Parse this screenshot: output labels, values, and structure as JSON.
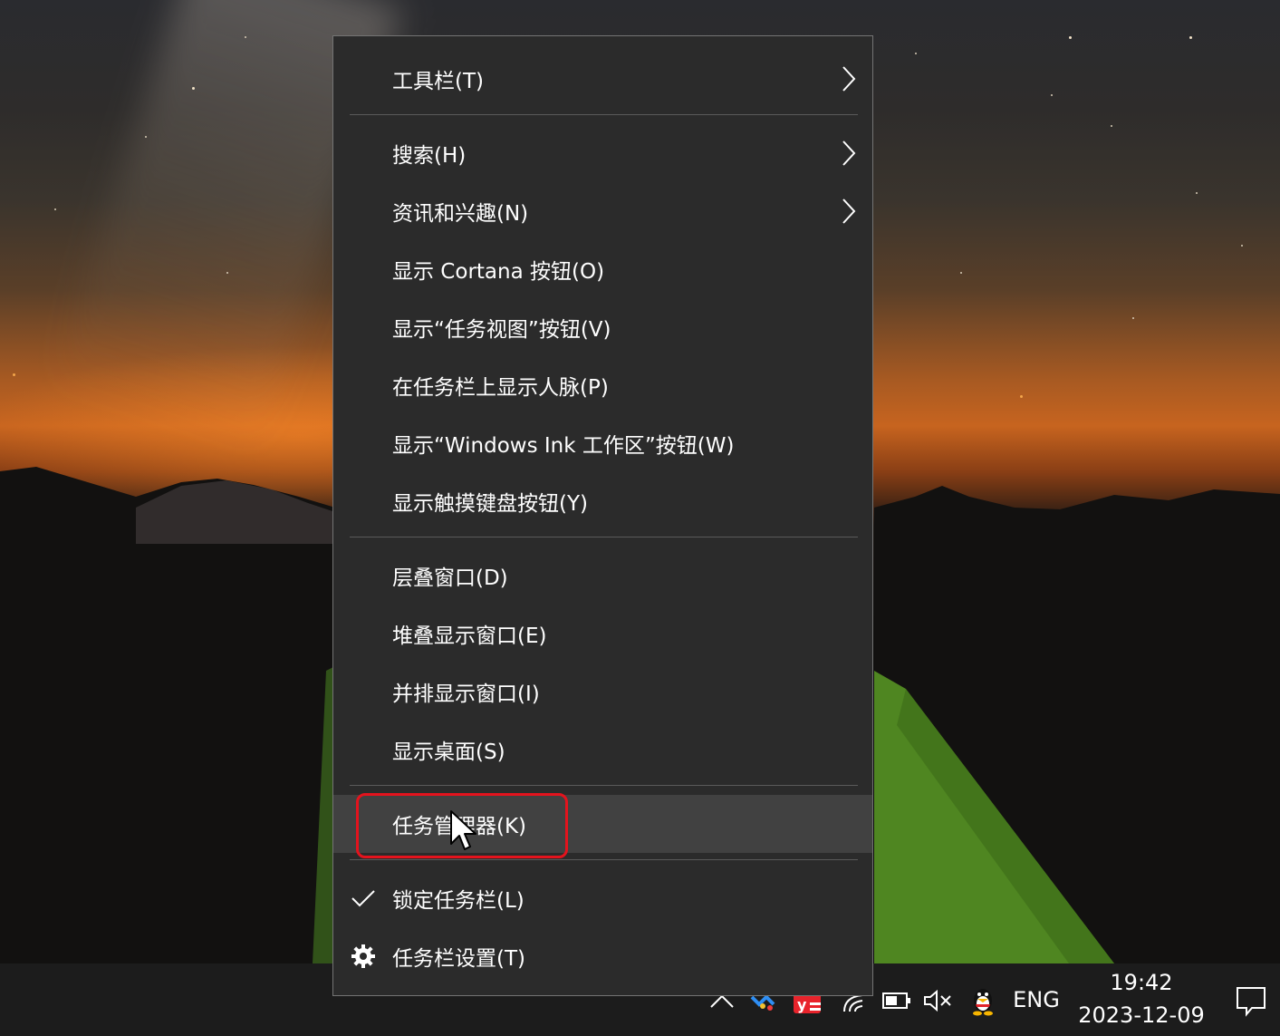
{
  "menu": {
    "items": [
      {
        "label": "工具栏(T)",
        "submenu": true
      },
      {
        "label": "搜索(H)",
        "submenu": true
      },
      {
        "label": "资讯和兴趣(N)",
        "submenu": true
      },
      {
        "label": "显示 Cortana 按钮(O)",
        "submenu": false
      },
      {
        "label": "显示“任务视图”按钮(V)",
        "submenu": false
      },
      {
        "label": "在任务栏上显示人脉(P)",
        "submenu": false
      },
      {
        "label": "显示“Windows Ink 工作区”按钮(W)",
        "submenu": false
      },
      {
        "label": "显示触摸键盘按钮(Y)",
        "submenu": false
      },
      {
        "label": "层叠窗口(D)",
        "submenu": false
      },
      {
        "label": "堆叠显示窗口(E)",
        "submenu": false
      },
      {
        "label": "并排显示窗口(I)",
        "submenu": false
      },
      {
        "label": "显示桌面(S)",
        "submenu": false
      },
      {
        "label": "任务管理器(K)",
        "submenu": false,
        "hovered": true
      },
      {
        "label": "锁定任务栏(L)",
        "submenu": false,
        "checked": true
      },
      {
        "label": "任务栏设置(T)",
        "submenu": false,
        "icon": "gear-icon"
      }
    ]
  },
  "taskbar": {
    "tray_icons": [
      "chevron-up-icon",
      "colorful-app-icon",
      "youdao-dict-icon",
      "network-icon",
      "battery-icon",
      "volume-muted-icon",
      "qq-icon"
    ],
    "language": "ENG",
    "time": "19:42",
    "date": "2023-12-09",
    "notification_icon": "action-center-icon"
  },
  "colors": {
    "menu_bg": "#2b2b2b",
    "hover_bg": "#414141",
    "highlight_border": "#e4131d",
    "taskbar_bg": "#1c1c1c"
  }
}
